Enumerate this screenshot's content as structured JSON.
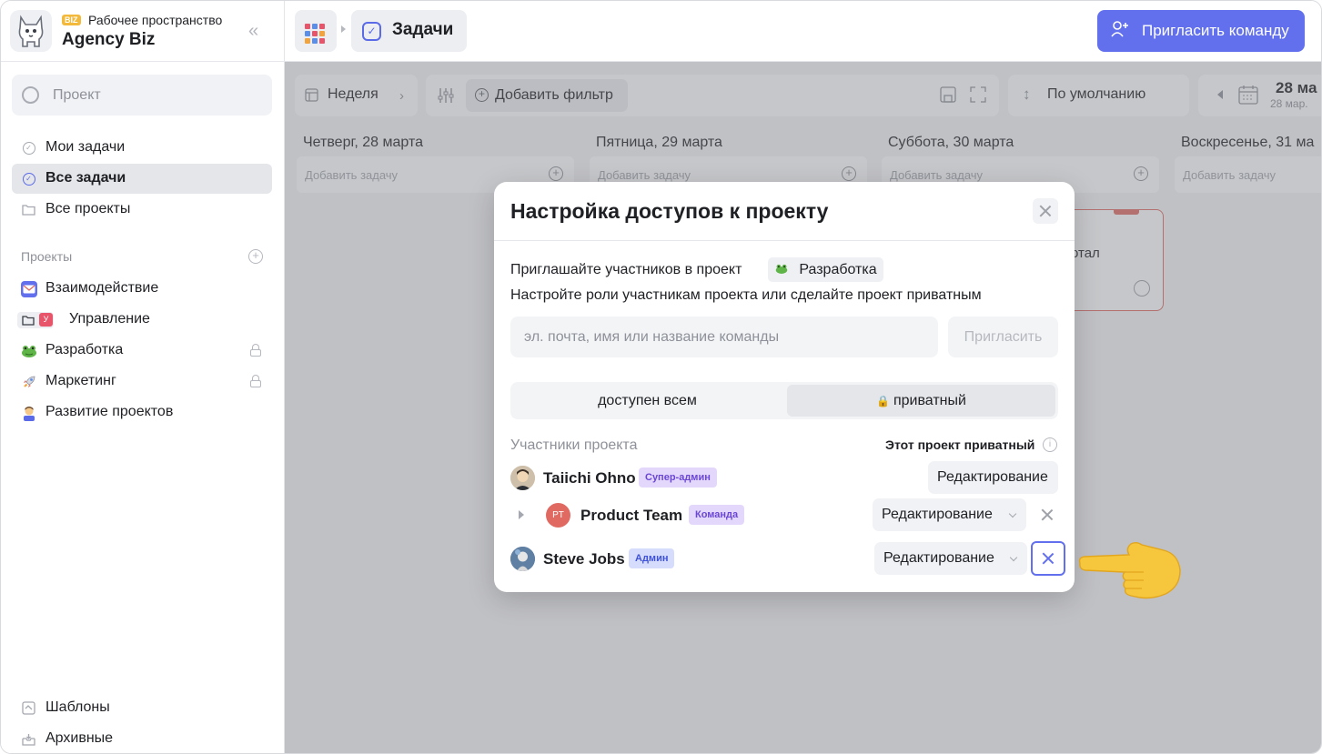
{
  "workspace": {
    "badge": "BIZ",
    "caption": "Рабочее пространство",
    "name": "Agency Biz"
  },
  "sidebar": {
    "search_placeholder": "Проект",
    "nav": [
      {
        "label": "Мои задачи",
        "active": false
      },
      {
        "label": "Все задачи",
        "active": true
      },
      {
        "label": "Все проекты",
        "active": false
      }
    ],
    "projects_title": "Проекты",
    "projects": [
      {
        "label": "Взаимодействие",
        "icon": "envelope-icon",
        "locked": false
      },
      {
        "label": "Управление",
        "icon": "folder-icon",
        "locked": false,
        "sub_badge": "У"
      },
      {
        "label": "Разработка",
        "icon": "frog-icon",
        "locked": true
      },
      {
        "label": "Маркетинг",
        "icon": "rocket-icon",
        "locked": true
      },
      {
        "label": "Развитие проектов",
        "icon": "person-icon",
        "locked": false
      }
    ],
    "footer": [
      {
        "label": "Шаблоны",
        "icon": "templates-icon"
      },
      {
        "label": "Архивные",
        "icon": "archive-icon"
      }
    ]
  },
  "topbar": {
    "current_section": "Задачи",
    "invite_team_label": "Пригласить команду"
  },
  "board": {
    "toolbar": {
      "week_label": "Неделя",
      "add_filter_label": "Добавить фильтр",
      "sort_label": "По умолчанию",
      "date_main": "28 ма",
      "date_sub": "28 мар."
    },
    "columns": [
      {
        "title": "Четверг, 28 марта",
        "add_placeholder": "Добавить задачу"
      },
      {
        "title": "Пятница, 29 марта",
        "add_placeholder": "Добавить задачу"
      },
      {
        "title": "Суббота, 30 марта",
        "add_placeholder": "Добавить задачу"
      },
      {
        "title": "Воскресенье, 31 ма",
        "add_placeholder": "Добавить задачу"
      }
    ],
    "card_fragment": "отал"
  },
  "modal": {
    "title": "Настройка доступов к проекту",
    "invite_line": "Приглашайте участников в проект",
    "project_chip": "Разработка",
    "roles_line": "Настройте роли участникам проекта или сделайте проект приватным",
    "input_placeholder": "эл. почта, имя или название команды",
    "invite_button": "Пригласить",
    "access_options": [
      {
        "label": "доступен всем",
        "selected": false
      },
      {
        "label": "приватный",
        "selected": true
      }
    ],
    "members_title": "Участники проекта",
    "private_note": "Этот проект приватный",
    "members": [
      {
        "name": "Taiichi Ohno",
        "role": "Супер-админ",
        "role_color": "#e3d8fb",
        "role_text_color": "#6b46d6",
        "permission": "Редактирование",
        "dropdown": false,
        "removable": false
      },
      {
        "name": "Product Team",
        "initials": "PT",
        "role": "Команда",
        "role_color": "#e3d8fb",
        "role_text_color": "#6b46d6",
        "permission": "Редактирование",
        "dropdown": true,
        "removable": true,
        "expandable": true
      },
      {
        "name": "Steve Jobs",
        "role": "Админ",
        "role_color": "#d6dcfb",
        "role_text_color": "#3f52d8",
        "permission": "Редактирование",
        "dropdown": true,
        "removable": true,
        "focused": true
      }
    ]
  },
  "colors": {
    "accent": "#6270ee",
    "danger": "#e06a62",
    "team_avatar": "#e06a62"
  }
}
